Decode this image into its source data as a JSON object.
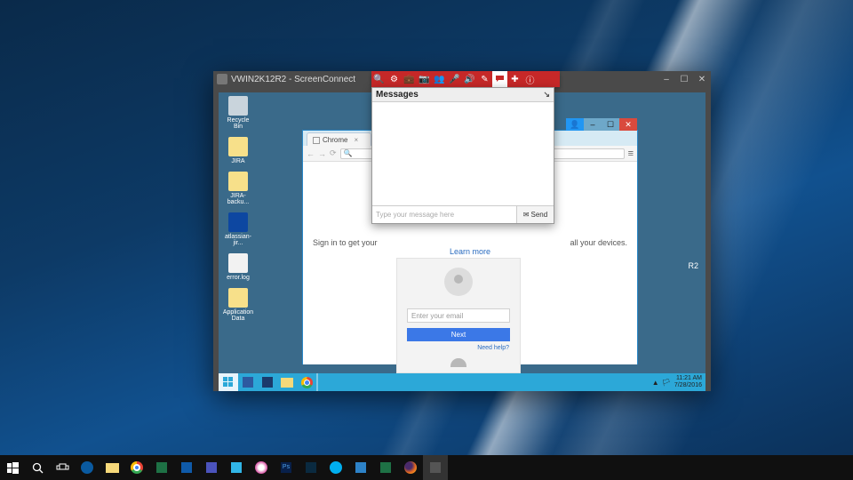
{
  "sc_window": {
    "title": "VWIN2K12R2 - ScreenConnect",
    "win_min": "–",
    "win_max": "☐",
    "win_close": "✕"
  },
  "red_toolbar": {
    "icons": [
      "search-icon",
      "gear-icon",
      "briefcase-icon",
      "camera-icon",
      "people-icon",
      "mic-icon",
      "sound-icon",
      "pencil-icon",
      "chat-icon",
      "plus-icon",
      "info-icon"
    ]
  },
  "messages": {
    "title": "Messages",
    "popout_glyph": "↘",
    "input_placeholder": "Type your message here",
    "send_icon": "✉",
    "send_label": "Send"
  },
  "remote_desktop": {
    "icons": [
      {
        "name": "recycle-bin",
        "label": "Recycle Bin",
        "cls": "bin"
      },
      {
        "name": "jira",
        "label": "JIRA",
        "cls": ""
      },
      {
        "name": "jira-backup",
        "label": "JIRA-backu...",
        "cls": ""
      },
      {
        "name": "atlassian-jira",
        "label": "atlassian-jir...",
        "cls": "app"
      },
      {
        "name": "error-log",
        "label": "error.log",
        "cls": "file"
      },
      {
        "name": "application-data",
        "label": "Application Data",
        "cls": ""
      }
    ],
    "clock_time": "11:21 AM",
    "clock_date": "7/28/2016",
    "tray_flag": "▲",
    "tray_net": "⬚",
    "edge_text": "R2"
  },
  "chrome": {
    "tab_label": "Chrome",
    "tab_close": "×",
    "nav_back": "←",
    "nav_fwd": "→",
    "nav_reload": "⟳",
    "menu": "≡",
    "lock_glyph": "🔍",
    "signin_left": "Sign in to get your",
    "signin_right": "all your devices.",
    "learn_more": "Learn more",
    "email_placeholder": "Enter your email",
    "next_label": "Next",
    "need_help": "Need help?",
    "ctrl_user": "👤",
    "ctrl_min": "–",
    "ctrl_max": "☐",
    "ctrl_close": "✕"
  }
}
